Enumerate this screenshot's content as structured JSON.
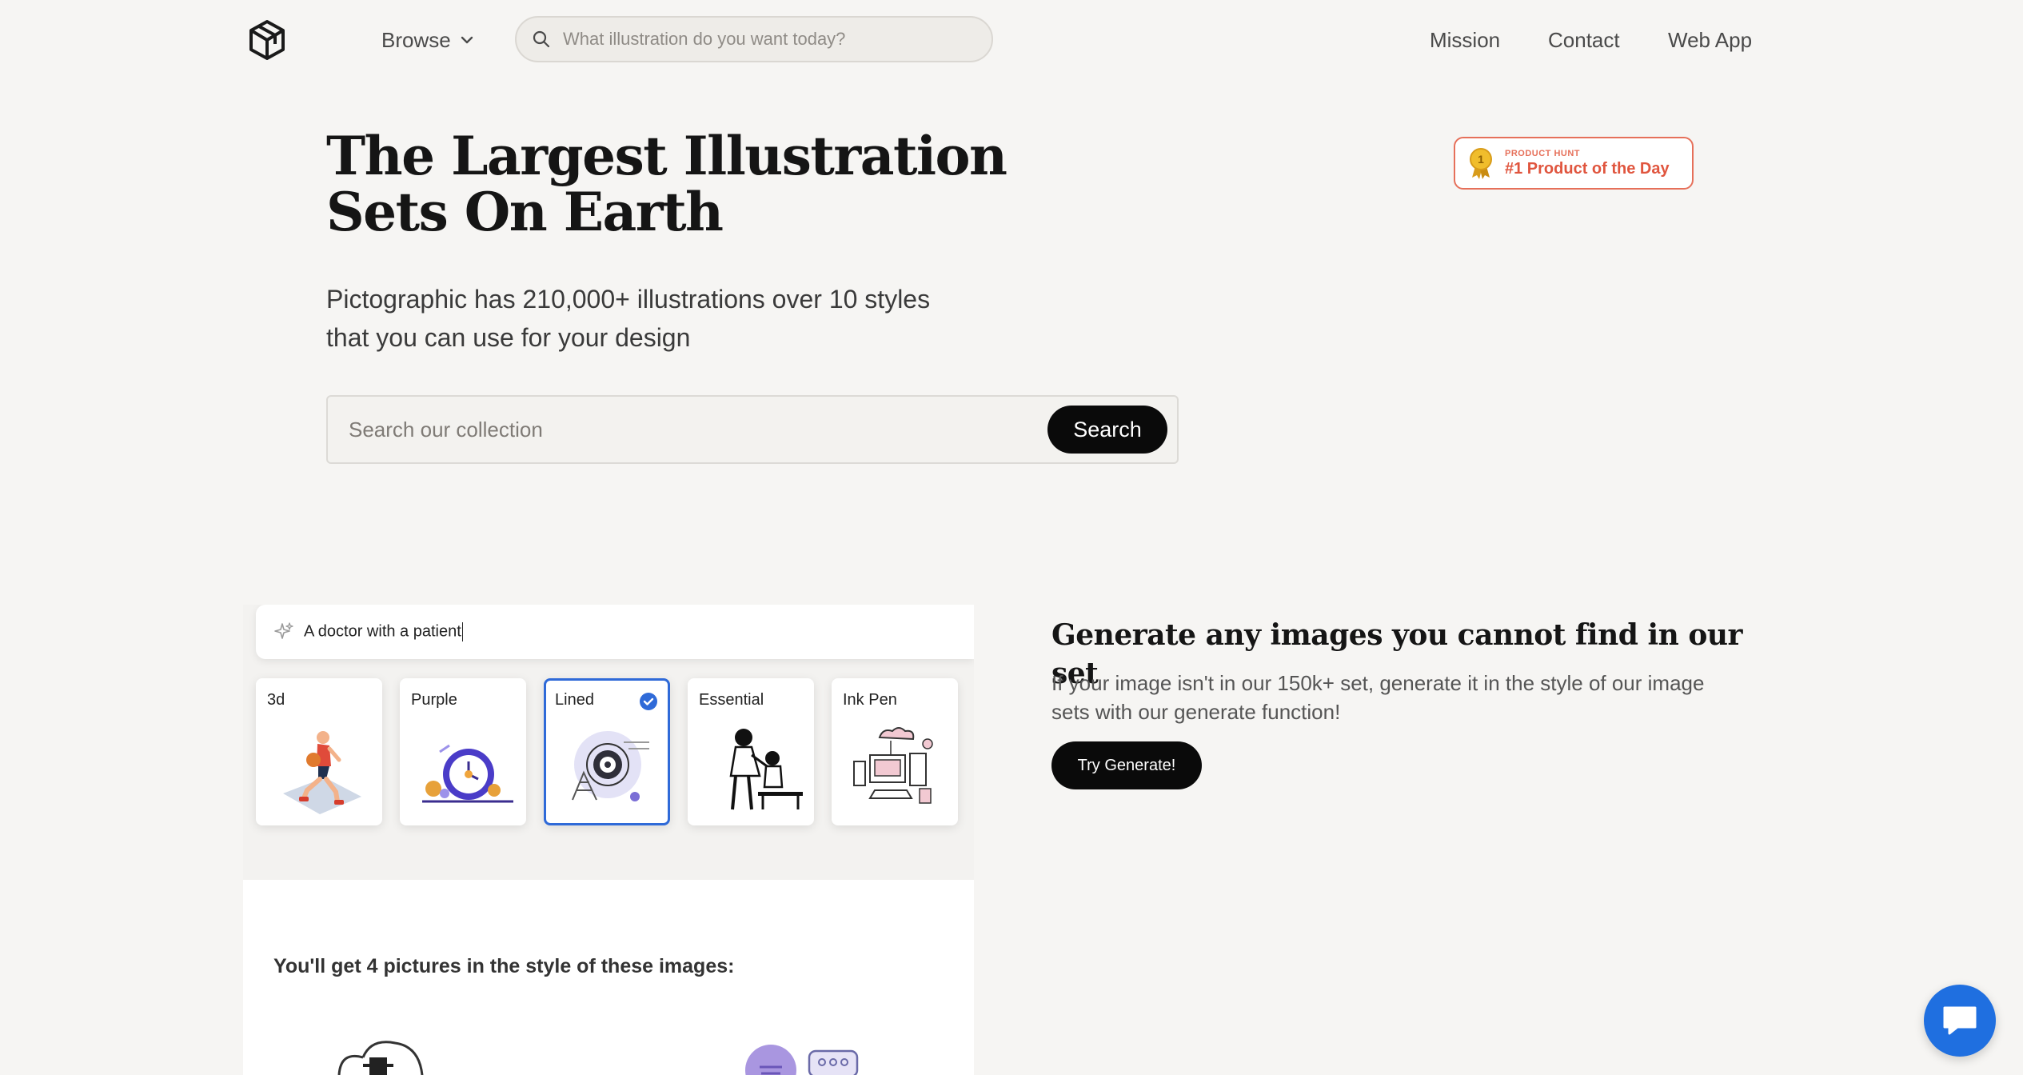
{
  "header": {
    "browse_label": "Browse",
    "search_placeholder": "What illustration do you want today?",
    "nav": [
      "Mission",
      "Contact",
      "Web App"
    ]
  },
  "hero": {
    "title": "The Largest Illustration Sets On Earth",
    "subtitle_line1": "Pictographic has 210,000+ illustrations over 10 styles",
    "subtitle_line2": "that you can use for your design",
    "search_placeholder": "Search our collection",
    "search_button": "Search"
  },
  "badge": {
    "kicker": "PRODUCT HUNT",
    "text": "#1 Product of the Day",
    "medal_number": "1"
  },
  "demo": {
    "prompt_text": "A doctor with a patient",
    "styles": [
      {
        "label": "3d",
        "selected": false
      },
      {
        "label": "Purple",
        "selected": false
      },
      {
        "label": "Lined",
        "selected": true
      },
      {
        "label": "Essential",
        "selected": false
      },
      {
        "label": "Ink Pen",
        "selected": false
      }
    ],
    "caption": "You'll get 4 pictures in the style of these images:"
  },
  "generate": {
    "title": "Generate any images you cannot find in our set",
    "description": "If your image isn't in our 150k+ set, generate it in the style of our image sets with our generate function!",
    "button": "Try Generate!"
  },
  "colors": {
    "background": "#f6f5f3",
    "primary_button": "#0a0a0a",
    "badge_accent": "#e0553e",
    "selected_accent": "#2f6ad8",
    "chat_button": "#1f6fe0"
  }
}
